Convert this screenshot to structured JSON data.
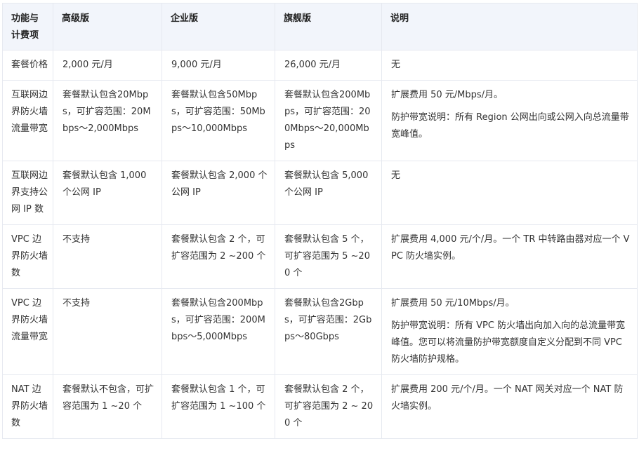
{
  "table": {
    "headers": [
      "功能与计费项",
      "高级版",
      "企业版",
      "旗舰版",
      "说明"
    ],
    "rows": [
      {
        "feature": "套餐价格",
        "advanced": "2,000 元/月",
        "enterprise": "9,000 元/月",
        "flagship": "26,000 元/月",
        "note": [
          "无"
        ]
      },
      {
        "feature": "互联网边界防火墙流量带宽",
        "advanced": "套餐默认包含20Mbps，可扩容范围：20Mbps～2,000Mbps",
        "enterprise": "套餐默认包含50Mbps，可扩容范围：50Mbps～10,000Mbps",
        "flagship": "套餐默认包含200Mbps，可扩容范围：200Mbps～20,000Mbps",
        "note": [
          "扩展费用 50 元/Mbps/月。",
          "防护带宽说明：所有 Region 公网出向或公网入向总流量带宽峰值。"
        ]
      },
      {
        "feature": "互联网边界支持公网 IP 数",
        "advanced": "套餐默认包含 1,000 个公网 IP",
        "enterprise": "套餐默认包含 2,000 个公网 IP",
        "flagship": "套餐默认包含 5,000 个公网 IP",
        "note": [
          "无"
        ]
      },
      {
        "feature": "VPC 边界防火墙数",
        "advanced": "不支持",
        "enterprise": "套餐默认包含 2 个，可扩容范围为 2 ~200 个",
        "flagship": "套餐默认包含 5 个，可扩容范围为 5 ~200 个",
        "note": [
          "扩展费用 4,000 元/个/月。一个 TR 中转路由器对应一个 VPC 防火墙实例。"
        ]
      },
      {
        "feature": "VPC 边界防火墙流量带宽",
        "advanced": "不支持",
        "enterprise": "套餐默认包含200Mbps，可扩容范围：200Mbps～5,000Mbps",
        "flagship": "套餐默认包含2Gbps，可扩容范围：2Gbps～80Gbps",
        "note": [
          "扩展费用 50 元/10Mbps/月。",
          "防护带宽说明：所有 VPC 防火墙出向加入向的总流量带宽峰值。您可以将流量防护带宽额度自定义分配到不同 VPC 防火墙防护规格。"
        ]
      },
      {
        "feature": "NAT 边界防火墙数",
        "advanced": "套餐默认不包含，可扩容范围为 1 ~20 个",
        "enterprise": "套餐默认包含 1 个，可扩容范围为 1 ~100 个",
        "flagship": "套餐默认包含 2 个，可扩容范围为 2 ~ 200 个",
        "note": [
          "扩展费用 200 元/个/月。一个 NAT 网关对应一个 NAT 防火墙实例。"
        ]
      }
    ]
  }
}
